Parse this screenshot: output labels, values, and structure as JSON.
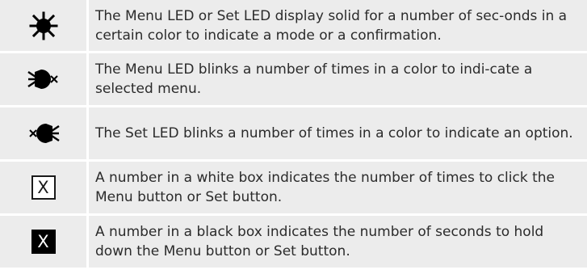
{
  "rows": [
    {
      "icon": "led-solid-icon",
      "description": "The Menu LED or Set LED display solid for a number of sec-onds in a certain color to indicate a mode or a confirmation."
    },
    {
      "icon": "menu-led-blink-icon",
      "description": "The Menu LED blinks a number of times in a color to indi-cate a selected menu."
    },
    {
      "icon": "set-led-blink-icon",
      "description": "The Set LED blinks a number of times in a color to indicate an option."
    },
    {
      "icon": "white-box-icon",
      "box_label": "X",
      "description": "A number in a white box indicates the number of times to click the Menu button or Set button."
    },
    {
      "icon": "black-box-icon",
      "box_label": "X",
      "description": "A number in a black box indicates the number of seconds to hold down the Menu button or Set button."
    }
  ]
}
